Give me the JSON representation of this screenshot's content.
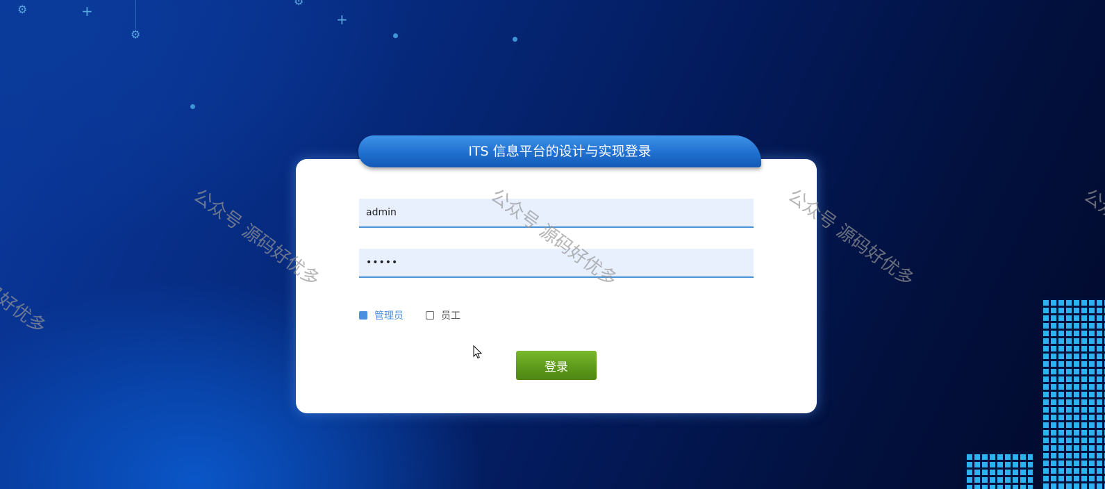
{
  "login": {
    "title": "ITS 信息平台的设计与实现登录",
    "username_value": "admin",
    "password_value": "•••••",
    "roles": [
      {
        "label": "管理员",
        "checked": true
      },
      {
        "label": "员工",
        "checked": false
      }
    ],
    "submit_label": "登录"
  },
  "watermark": {
    "text": "公众号 源码好优多"
  },
  "colors": {
    "accent": "#1f6fcf",
    "button": "#5e9b1c",
    "role_selected": "#4a8fe0"
  },
  "icons": {
    "decoration": [
      "gear-icon",
      "plus-icon"
    ],
    "cursor": "mouse-pointer-icon"
  }
}
